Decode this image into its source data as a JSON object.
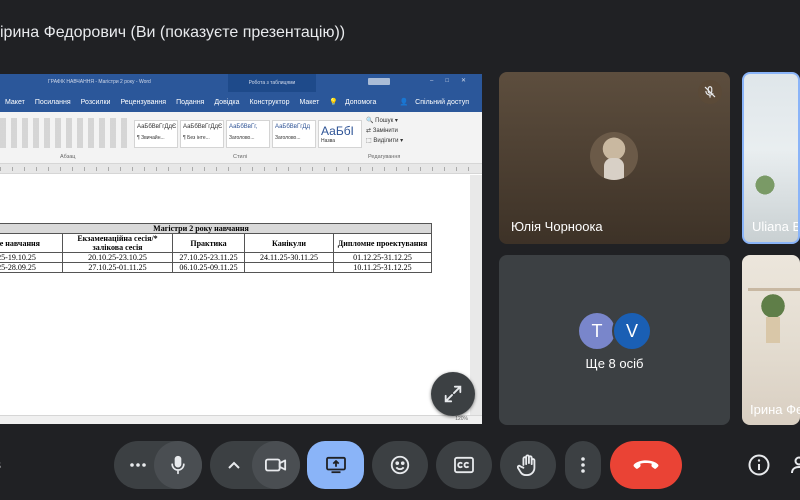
{
  "meeting": {
    "presenter_title": "ірина Федорович (Ви (показуєте презентацію))"
  },
  "word": {
    "title_doc": "ГРАФІК НАВЧАННЯ - Магістри 2 року - Word",
    "context_tab": "Робота з таблицями",
    "tabs": [
      "Макет",
      "Посилання",
      "Розсилки",
      "Рецензування",
      "Подання",
      "Довідка",
      "Конструктор",
      "Макет"
    ],
    "tell_me": "Допомога",
    "share": "Спільний доступ",
    "styles": [
      {
        "sample": "АаБбВвГгДдЄ",
        "name": "¶ Звичайн..."
      },
      {
        "sample": "АаБбВвГгДдЄ",
        "name": "¶ Без інте..."
      },
      {
        "sample": "АаБбВвГг,",
        "name": "Заголово..."
      },
      {
        "sample": "АаБбВвГгДд",
        "name": "Заголово..."
      },
      {
        "sample": "АаБбІ",
        "name": "Назва"
      }
    ],
    "groups": {
      "paragraph": "Абзац",
      "styles": "Стилі",
      "editing": "Редагування"
    },
    "editing": [
      "Пошук",
      "Замінити",
      "Виділити"
    ],
    "table": {
      "caption": "Магістри 2 року навчання",
      "headers": [
        "ше навчання",
        "Екзаменаційна сесія/* залікова сесія",
        "Практика",
        "Канікули",
        "Дипломне проектування"
      ],
      "rows": [
        [
          "25-19.10.25",
          "20.10.25-23.10.25",
          "27.10.25-23.11.25",
          "24.11.25-30.11.25",
          "01.12.25-31.12.25"
        ],
        [
          "25-28.09.25",
          "27.10.25-01.11.25",
          "06.10.25-09.11.25",
          "",
          "10.11.25-31.12.25"
        ]
      ]
    },
    "zoom": "120%"
  },
  "participants": {
    "yulia": "Юлія Чорноока",
    "uliana": "Uliana Bo",
    "more_label": "Ще 8 осіб",
    "more_avatars": [
      "T",
      "V"
    ],
    "iryna": "Ірина Фе"
  },
  "controls": {
    "left_edge_text": "s"
  },
  "colors": {
    "background": "#202124",
    "tile": "#3c4043",
    "present_active": "#8ab4f8",
    "end_call": "#ea4335",
    "word_blue": "#2b579a"
  }
}
